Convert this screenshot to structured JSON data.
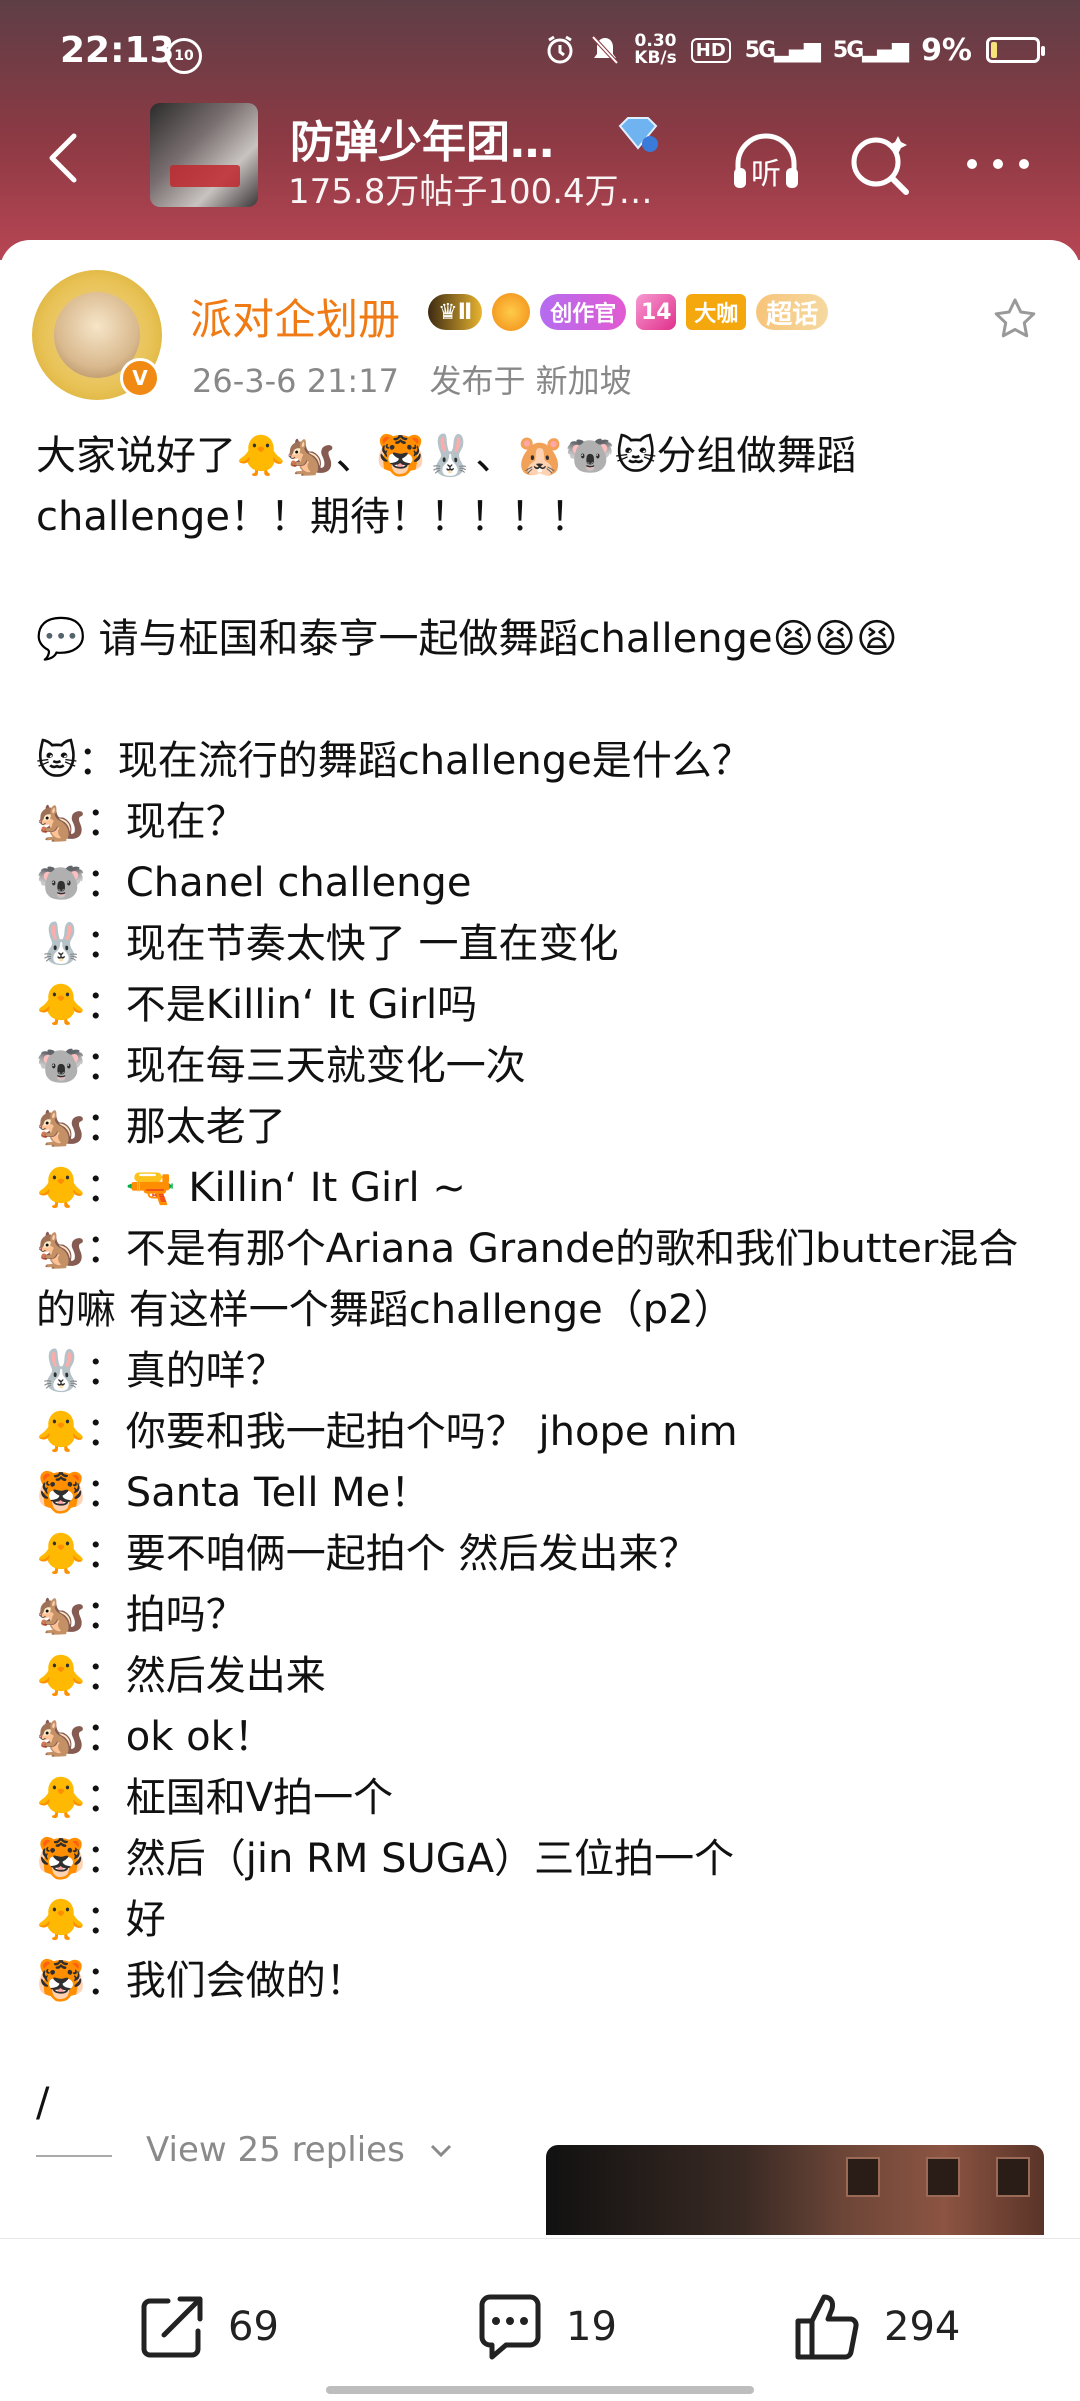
{
  "status_bar": {
    "time": "22:13",
    "notif_badge": "10",
    "net_speed_top": "0.30",
    "net_speed_unit": "KB/s",
    "hd_label": "HD",
    "signal1": "5G",
    "signal2": "5G",
    "battery": "9%"
  },
  "header": {
    "title": "防弹少年团…",
    "subtitle": "175.8万帖子100.4万…",
    "listen_label": "听"
  },
  "post": {
    "author": "派对企划册",
    "crown_level": "Ⅱ",
    "creator_badge": "创作官",
    "gem_level": "14",
    "dk_badge": "大咖",
    "topic_badge": "超话",
    "date": "26-3-6 21:17",
    "location": "发布于 新加坡",
    "paragraphs": [
      "大家说好了🐥🐿️、🐯🐰、🐹🐨🐱分组做舞蹈challenge！！期待！！！！！",
      "",
      "💬 请与柾国和泰亨一起做舞蹈challenge😫😫😫",
      "",
      "🐱：现在流行的舞蹈challenge是什么？",
      "🐿️：现在？",
      "🐨：Chanel challenge",
      "🐰：现在节奏太快了 一直在变化",
      "🐥：不是Killin‘ It Girl吗",
      "🐨：现在每三天就变化一次",
      "🐿️：那太老了",
      "🐥：🔫 Killin‘ It Girl ~",
      "🐿️：不是有那个Ariana Grande的歌和我们butter混合的嘛 有这样一个舞蹈challenge（p2）",
      "🐰：真的咩？",
      "🐥：你要和我一起拍个吗？ jhope nim",
      "🐯：Santa Tell Me！",
      "🐥：要不咱俩一起拍个 然后发出来？",
      "🐿️：拍吗？",
      "🐥：然后发出来",
      "🐿️：ok ok！",
      "🐥：柾国和V拍一个",
      "🐯：然后（jin RM SUGA）三位拍一个",
      "🐥：好",
      "🐯：我们会做的！",
      "",
      "/"
    ],
    "view_replies": "View 25 replies"
  },
  "actions": {
    "share_count": "69",
    "comment_count": "19",
    "like_count": "294"
  },
  "colors": {
    "header_gradient_top": "#5e3e46",
    "header_gradient_bottom": "#b84654",
    "author_name": "#f07a14",
    "meta_text": "#888888"
  },
  "icons": [
    "back-arrow-icon",
    "listen-icon",
    "search-icon",
    "more-icon",
    "star-icon",
    "share-icon",
    "comment-icon",
    "like-icon"
  ]
}
